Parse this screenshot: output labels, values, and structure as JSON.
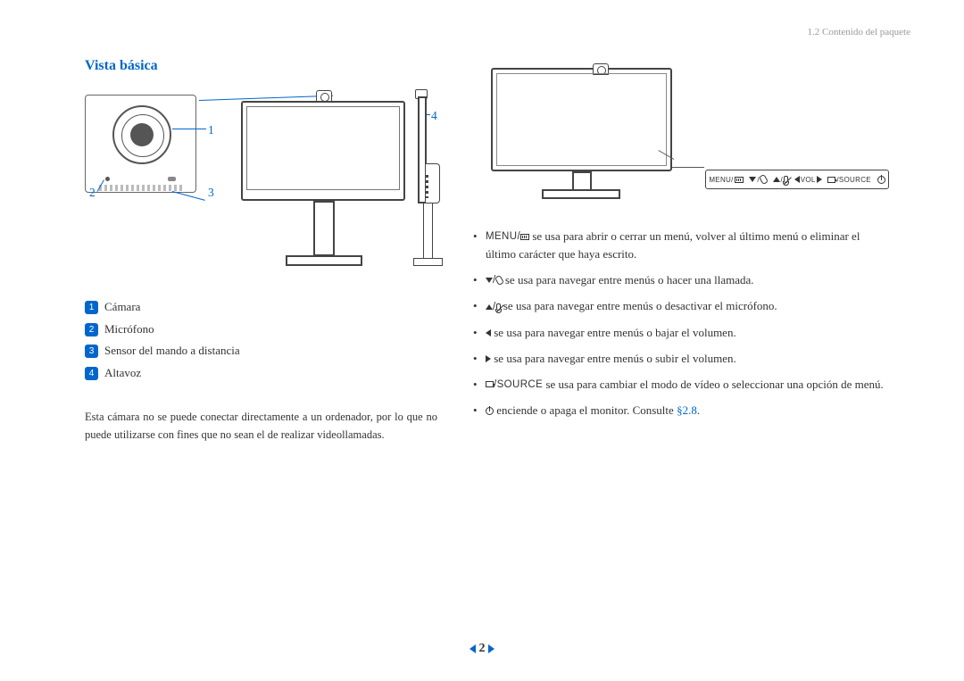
{
  "header": {
    "crumb": "1.2 Contenido del paquete"
  },
  "title": "Vista básica",
  "callouts": {
    "n1": "1",
    "n2": "2",
    "n3": "3",
    "n4": "4"
  },
  "legend": {
    "items": [
      {
        "num": "1",
        "label": "Cámara"
      },
      {
        "num": "2",
        "label": "Micrófono"
      },
      {
        "num": "3",
        "label": "Sensor del mando a distancia"
      },
      {
        "num": "4",
        "label": "Altavoz"
      }
    ]
  },
  "note": "Esta cámara no se puede conectar directamente a un ordenador, por lo que no puede utilizarse con fines que no sean el de realizar videollamadas.",
  "buttons_strip": {
    "b1": "MENU/",
    "b2": "VOL",
    "b3": "/SOURCE"
  },
  "bullets": {
    "b1_pre": "MENU/",
    "b1_txt": " se usa para abrir o cerrar un menú, volver al último menú o eliminar el último carácter que haya escrito.",
    "b2_txt": " se usa para navegar entre menús o hacer una llamada.",
    "b3_txt": " se usa para navegar entre menús o desactivar el micrófono.",
    "b4_txt": " se usa para navegar entre menús o bajar el volumen.",
    "b5_txt": " se usa para navegar entre menús o subir el volumen.",
    "b6_pre": "/SOURCE",
    "b6_txt": " se usa para cambiar el modo de vídeo o seleccionar una opción de menú.",
    "b7_txt": " enciende o apaga el monitor. Consulte ",
    "b7_ref": "§2.8",
    "b7_suf": "."
  },
  "pager": {
    "page": "2"
  }
}
